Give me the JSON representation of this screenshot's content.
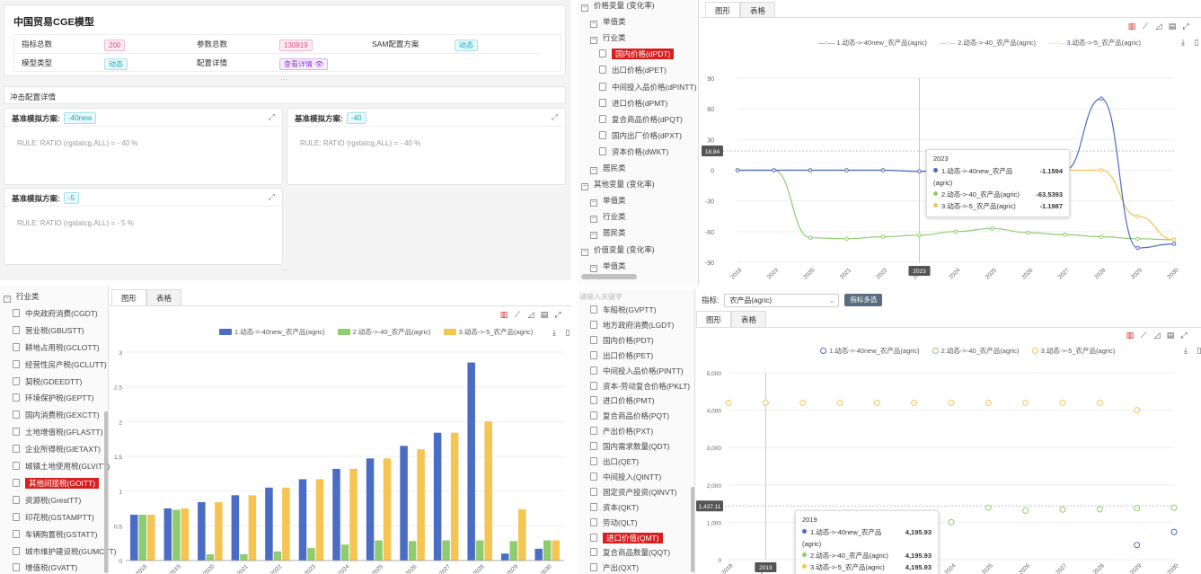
{
  "q1": {
    "title": "中国贸易CGE模型",
    "info": [
      {
        "label": "指标总数",
        "value": "200",
        "tag": "pink"
      },
      {
        "label": "参数总数",
        "value": "130819",
        "tag": "pink"
      },
      {
        "label": "SAM配置方案",
        "value": "动态",
        "tag": "cyan"
      },
      {
        "label": "模型类型",
        "value": "动态",
        "tag": "cyan"
      },
      {
        "label": "配置详情",
        "value": "查看详情 👁",
        "tag": "purple"
      }
    ],
    "shock_title": "冲击配置详情",
    "scenarios": [
      {
        "label": "基准模拟方案:",
        "tag": "-40new",
        "rule": "RULE: RATIO (rgstatcg,ALL) = - 40 %"
      },
      {
        "label": "基准模拟方案:",
        "tag": "-40",
        "rule": "RULE: RATIO (rgstatcg,ALL) = - 40 %"
      },
      {
        "label": "基准模拟方案:",
        "tag": "-5",
        "rule": "RULE: RATIO (rgstatcg,ALL) = - 5 %"
      }
    ]
  },
  "q2": {
    "tree": [
      {
        "type": "group",
        "label": "价格变量 (变化率)",
        "indent": 0
      },
      {
        "type": "group",
        "label": "单值类",
        "indent": 1
      },
      {
        "type": "group",
        "label": "行业类",
        "indent": 1
      },
      {
        "type": "leaf",
        "label": "国内价格(dPDT)",
        "indent": 2,
        "selected": true
      },
      {
        "type": "leaf",
        "label": "出口价格(dPET)",
        "indent": 2
      },
      {
        "type": "leaf",
        "label": "中间投入品价格(dPINTT)",
        "indent": 2
      },
      {
        "type": "leaf",
        "label": "进口价格(dPMT)",
        "indent": 2
      },
      {
        "type": "leaf",
        "label": "复合商品价格(dPQT)",
        "indent": 2
      },
      {
        "type": "leaf",
        "label": "国内出厂价格(dPXT)",
        "indent": 2
      },
      {
        "type": "leaf",
        "label": "资本价格(dWKT)",
        "indent": 2
      },
      {
        "type": "group",
        "label": "居民类",
        "indent": 1
      },
      {
        "type": "group",
        "label": "其他变量 (变化率)",
        "indent": 0
      },
      {
        "type": "group",
        "label": "单值类",
        "indent": 1
      },
      {
        "type": "group",
        "label": "行业类",
        "indent": 1
      },
      {
        "type": "group",
        "label": "居民类",
        "indent": 1
      },
      {
        "type": "group",
        "label": "价值变量 (变化率)",
        "indent": 0
      },
      {
        "type": "group",
        "label": "单值类",
        "indent": 1
      }
    ],
    "tabs": [
      "图形",
      "表格"
    ],
    "y_marker": "18.84",
    "x_marker": "2023",
    "tooltip": {
      "title": "2023",
      "rows": [
        {
          "name": "1.动态->-40new_农产品(agric)",
          "value": "-1.1594",
          "color": "#4b6cc4"
        },
        {
          "name": "2.动态->-40_农产品(agric)",
          "value": "-63.5393",
          "color": "#8fcc6f"
        },
        {
          "name": "3.动态->-5_农产品(agric)",
          "value": "-1.1987",
          "color": "#f5c451"
        }
      ]
    }
  },
  "q3": {
    "tree": [
      {
        "type": "group",
        "label": "行业类",
        "indent": 0
      },
      {
        "type": "leaf",
        "label": "中央政府消费(CGDT)",
        "indent": 1
      },
      {
        "type": "leaf",
        "label": "营业税(GBUSTT)",
        "indent": 1
      },
      {
        "type": "leaf",
        "label": "耕地占用税(GCLOTT)",
        "indent": 1
      },
      {
        "type": "leaf",
        "label": "经营性房产税(GCLUTT)",
        "indent": 1
      },
      {
        "type": "leaf",
        "label": "契税(GDEEDTT)",
        "indent": 1
      },
      {
        "type": "leaf",
        "label": "环境保护税(GEPTT)",
        "indent": 1
      },
      {
        "type": "leaf",
        "label": "国内消费税(GEXCTT)",
        "indent": 1
      },
      {
        "type": "leaf",
        "label": "土地增值税(GFLASTT)",
        "indent": 1
      },
      {
        "type": "leaf",
        "label": "企业所得税(GIETAXT)",
        "indent": 1
      },
      {
        "type": "leaf",
        "label": "城镇土地使用税(GLVITT)",
        "indent": 1
      },
      {
        "type": "leaf",
        "label": "其他间接税(GOITT)",
        "indent": 1,
        "selected": true
      },
      {
        "type": "leaf",
        "label": "资源税(GrestTT)",
        "indent": 1
      },
      {
        "type": "leaf",
        "label": "印花税(GSTAMPTT)",
        "indent": 1
      },
      {
        "type": "leaf",
        "label": "车辆购置税(GSTATT)",
        "indent": 1
      },
      {
        "type": "leaf",
        "label": "城市维护建设税(GUMCTT)",
        "indent": 1
      },
      {
        "type": "leaf",
        "label": "增值税(GVATT)",
        "indent": 1
      }
    ],
    "tabs": [
      "图形",
      "表格"
    ]
  },
  "q4": {
    "search_placeholder": "请输入关键字",
    "indicator_label": "指标:",
    "indicator_value": "农产品(agric)",
    "multi_button": "指标多选",
    "tree": [
      {
        "type": "leaf",
        "label": "车船税(GVPTT)",
        "indent": 1
      },
      {
        "type": "leaf",
        "label": "地方政府消费(LGDT)",
        "indent": 1
      },
      {
        "type": "leaf",
        "label": "国内价格(PDT)",
        "indent": 1
      },
      {
        "type": "leaf",
        "label": "出口价格(PET)",
        "indent": 1
      },
      {
        "type": "leaf",
        "label": "中间投入品价格(PINTT)",
        "indent": 1
      },
      {
        "type": "leaf",
        "label": "资本-劳动复合价格(PKLT)",
        "indent": 1
      },
      {
        "type": "leaf",
        "label": "进口价格(PMT)",
        "indent": 1
      },
      {
        "type": "leaf",
        "label": "复合商品价格(PQT)",
        "indent": 1
      },
      {
        "type": "leaf",
        "label": "产出价格(PXT)",
        "indent": 1
      },
      {
        "type": "leaf",
        "label": "国内需求数量(QDT)",
        "indent": 1
      },
      {
        "type": "leaf",
        "label": "出口(QET)",
        "indent": 1
      },
      {
        "type": "leaf",
        "label": "中间投入(QINTT)",
        "indent": 1
      },
      {
        "type": "leaf",
        "label": "固定资产投资(QINVT)",
        "indent": 1
      },
      {
        "type": "leaf",
        "label": "资本(QKT)",
        "indent": 1
      },
      {
        "type": "leaf",
        "label": "劳动(QLT)",
        "indent": 1
      },
      {
        "type": "leaf",
        "label": "进口价值(QMT)",
        "indent": 1,
        "selected": true
      },
      {
        "type": "leaf",
        "label": "复合商品数量(QQT)",
        "indent": 1
      },
      {
        "type": "leaf",
        "label": "产出(QXT)",
        "indent": 1
      }
    ],
    "tabs": [
      "图形",
      "表格"
    ],
    "y_marker": "1,437.11",
    "x_marker": "2019",
    "tooltip": {
      "title": "2019",
      "rows": [
        {
          "name": "1.动态->-40new_农产品(agric)",
          "value": "4,195.93",
          "color": "#4b6cc4"
        },
        {
          "name": "2.动态->-40_农产品(agric)",
          "value": "4,195.93",
          "color": "#8fcc6f"
        },
        {
          "name": "3.动态->-5_农产品(agric)",
          "value": "4,195.93",
          "color": "#f5c451"
        }
      ]
    }
  },
  "toolbar_icons": [
    "bar-chart-icon",
    "line-chart-icon",
    "area-chart-icon",
    "stack-chart-icon",
    "fullscreen-icon"
  ],
  "colors": {
    "s1": "#4b6cc4",
    "s2": "#8fcc6f",
    "s3": "#f5c451",
    "selected": "#d81e1e"
  },
  "chart_data": [
    {
      "type": "line",
      "x": [
        "2018",
        "2019",
        "2020",
        "2021",
        "2022",
        "2023",
        "2024",
        "2025",
        "2026",
        "2027",
        "2028",
        "2029",
        "2030"
      ],
      "series": [
        {
          "name": "1.动态->-40new_农产品(agric)",
          "values": [
            0,
            0,
            0,
            0,
            0,
            -1.16,
            0,
            0,
            0,
            0,
            70,
            -76,
            -72
          ]
        },
        {
          "name": "2.动态->-40_农产品(agric)",
          "values": [
            0,
            0,
            -66,
            -67,
            -65,
            -63.5,
            -60,
            -57,
            -61,
            -63,
            -65,
            -67,
            -68
          ]
        },
        {
          "name": "3.动态->-5_农产品(agric)",
          "values": [
            0,
            0,
            0,
            0,
            0,
            -1.2,
            0,
            0,
            0,
            0,
            0,
            -45,
            -68
          ]
        }
      ],
      "ylim": [
        -90,
        90
      ],
      "yticks": [
        90,
        60,
        30,
        0,
        -30,
        -60,
        -90
      ]
    },
    {
      "type": "bar",
      "categories": [
        "2018",
        "2019",
        "2020",
        "2021",
        "2022",
        "2023",
        "2024",
        "2025",
        "2026",
        "2027",
        "2028",
        "2029",
        "2030"
      ],
      "series": [
        {
          "name": "1.动态->-40new_农产品(agric)",
          "values": [
            0.66,
            0.75,
            0.84,
            0.94,
            1.05,
            1.17,
            1.32,
            1.47,
            1.65,
            1.84,
            2.85,
            0.1,
            0.17
          ]
        },
        {
          "name": "2.动态->-40_农产品(agric)",
          "values": [
            0.66,
            0.73,
            0.09,
            0.09,
            0.13,
            0.18,
            0.23,
            0.29,
            0.28,
            0.29,
            0.29,
            0.28,
            0.29
          ]
        },
        {
          "name": "3.动态->-5_农产品(agric)",
          "values": [
            0.66,
            0.75,
            0.84,
            0.94,
            1.05,
            1.17,
            1.32,
            1.47,
            1.6,
            1.84,
            2.0,
            0.74,
            0.29
          ]
        }
      ],
      "ylim": [
        0,
        3
      ],
      "yticks": [
        3,
        2.5,
        2,
        1.5,
        1,
        0.5,
        0
      ]
    },
    {
      "type": "scatter",
      "x": [
        "2018",
        "2019",
        "2020",
        "2021",
        "2022",
        "2023",
        "2024",
        "2025",
        "2026",
        "2027",
        "2028",
        "2029",
        "2030"
      ],
      "series": [
        {
          "name": "1.动态->-40new_农产品(agric)",
          "values": [
            null,
            null,
            null,
            null,
            null,
            null,
            null,
            null,
            null,
            null,
            null,
            390,
            740
          ]
        },
        {
          "name": "2.动态->-40_农产品(agric)",
          "values": [
            null,
            null,
            null,
            null,
            null,
            null,
            1000,
            1390,
            1310,
            1340,
            1350,
            1380,
            1390
          ]
        },
        {
          "name": "3.动态->-5_农产品(agric)",
          "values": [
            4195.93,
            4195.93,
            4195.93,
            4195.93,
            4195.93,
            4195.93,
            4195.93,
            4195.93,
            4195.93,
            4195.93,
            4195.93,
            4000,
            null
          ]
        }
      ],
      "ylim": [
        0,
        5000
      ],
      "yticks": [
        5000,
        4000,
        3000,
        2000,
        1000,
        0
      ],
      "ytick_labels": [
        "5,000",
        "4,000",
        "3,000",
        "2,000",
        "1,000",
        "0"
      ]
    }
  ]
}
